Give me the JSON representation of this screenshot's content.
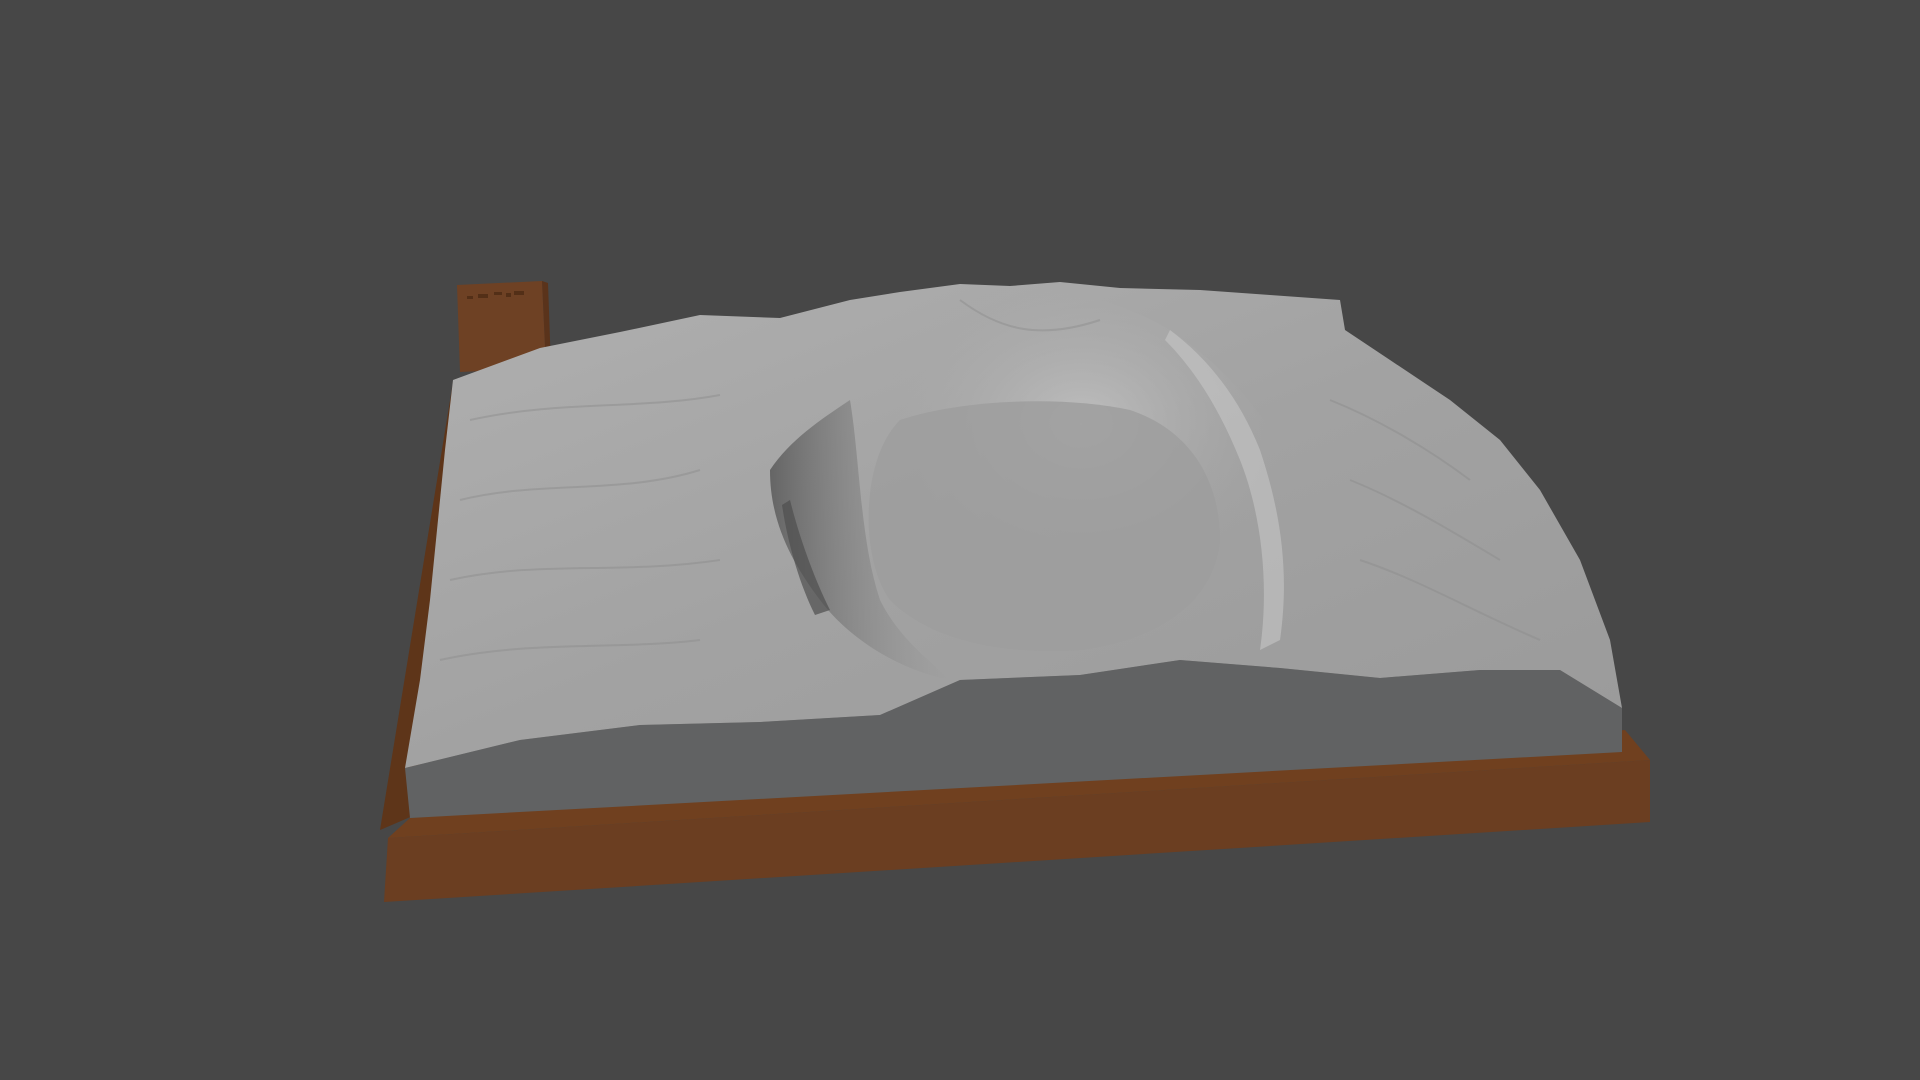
{
  "scene": {
    "background_color": "#474747",
    "model": {
      "subject": "terrain-relief-model",
      "terrain_color": "#a4a4a4",
      "terrain_side_color": "#616263",
      "base_color": "#6b3e21",
      "base_shadow_color": "#5a331b",
      "tab_color": "#6e4124"
    }
  }
}
